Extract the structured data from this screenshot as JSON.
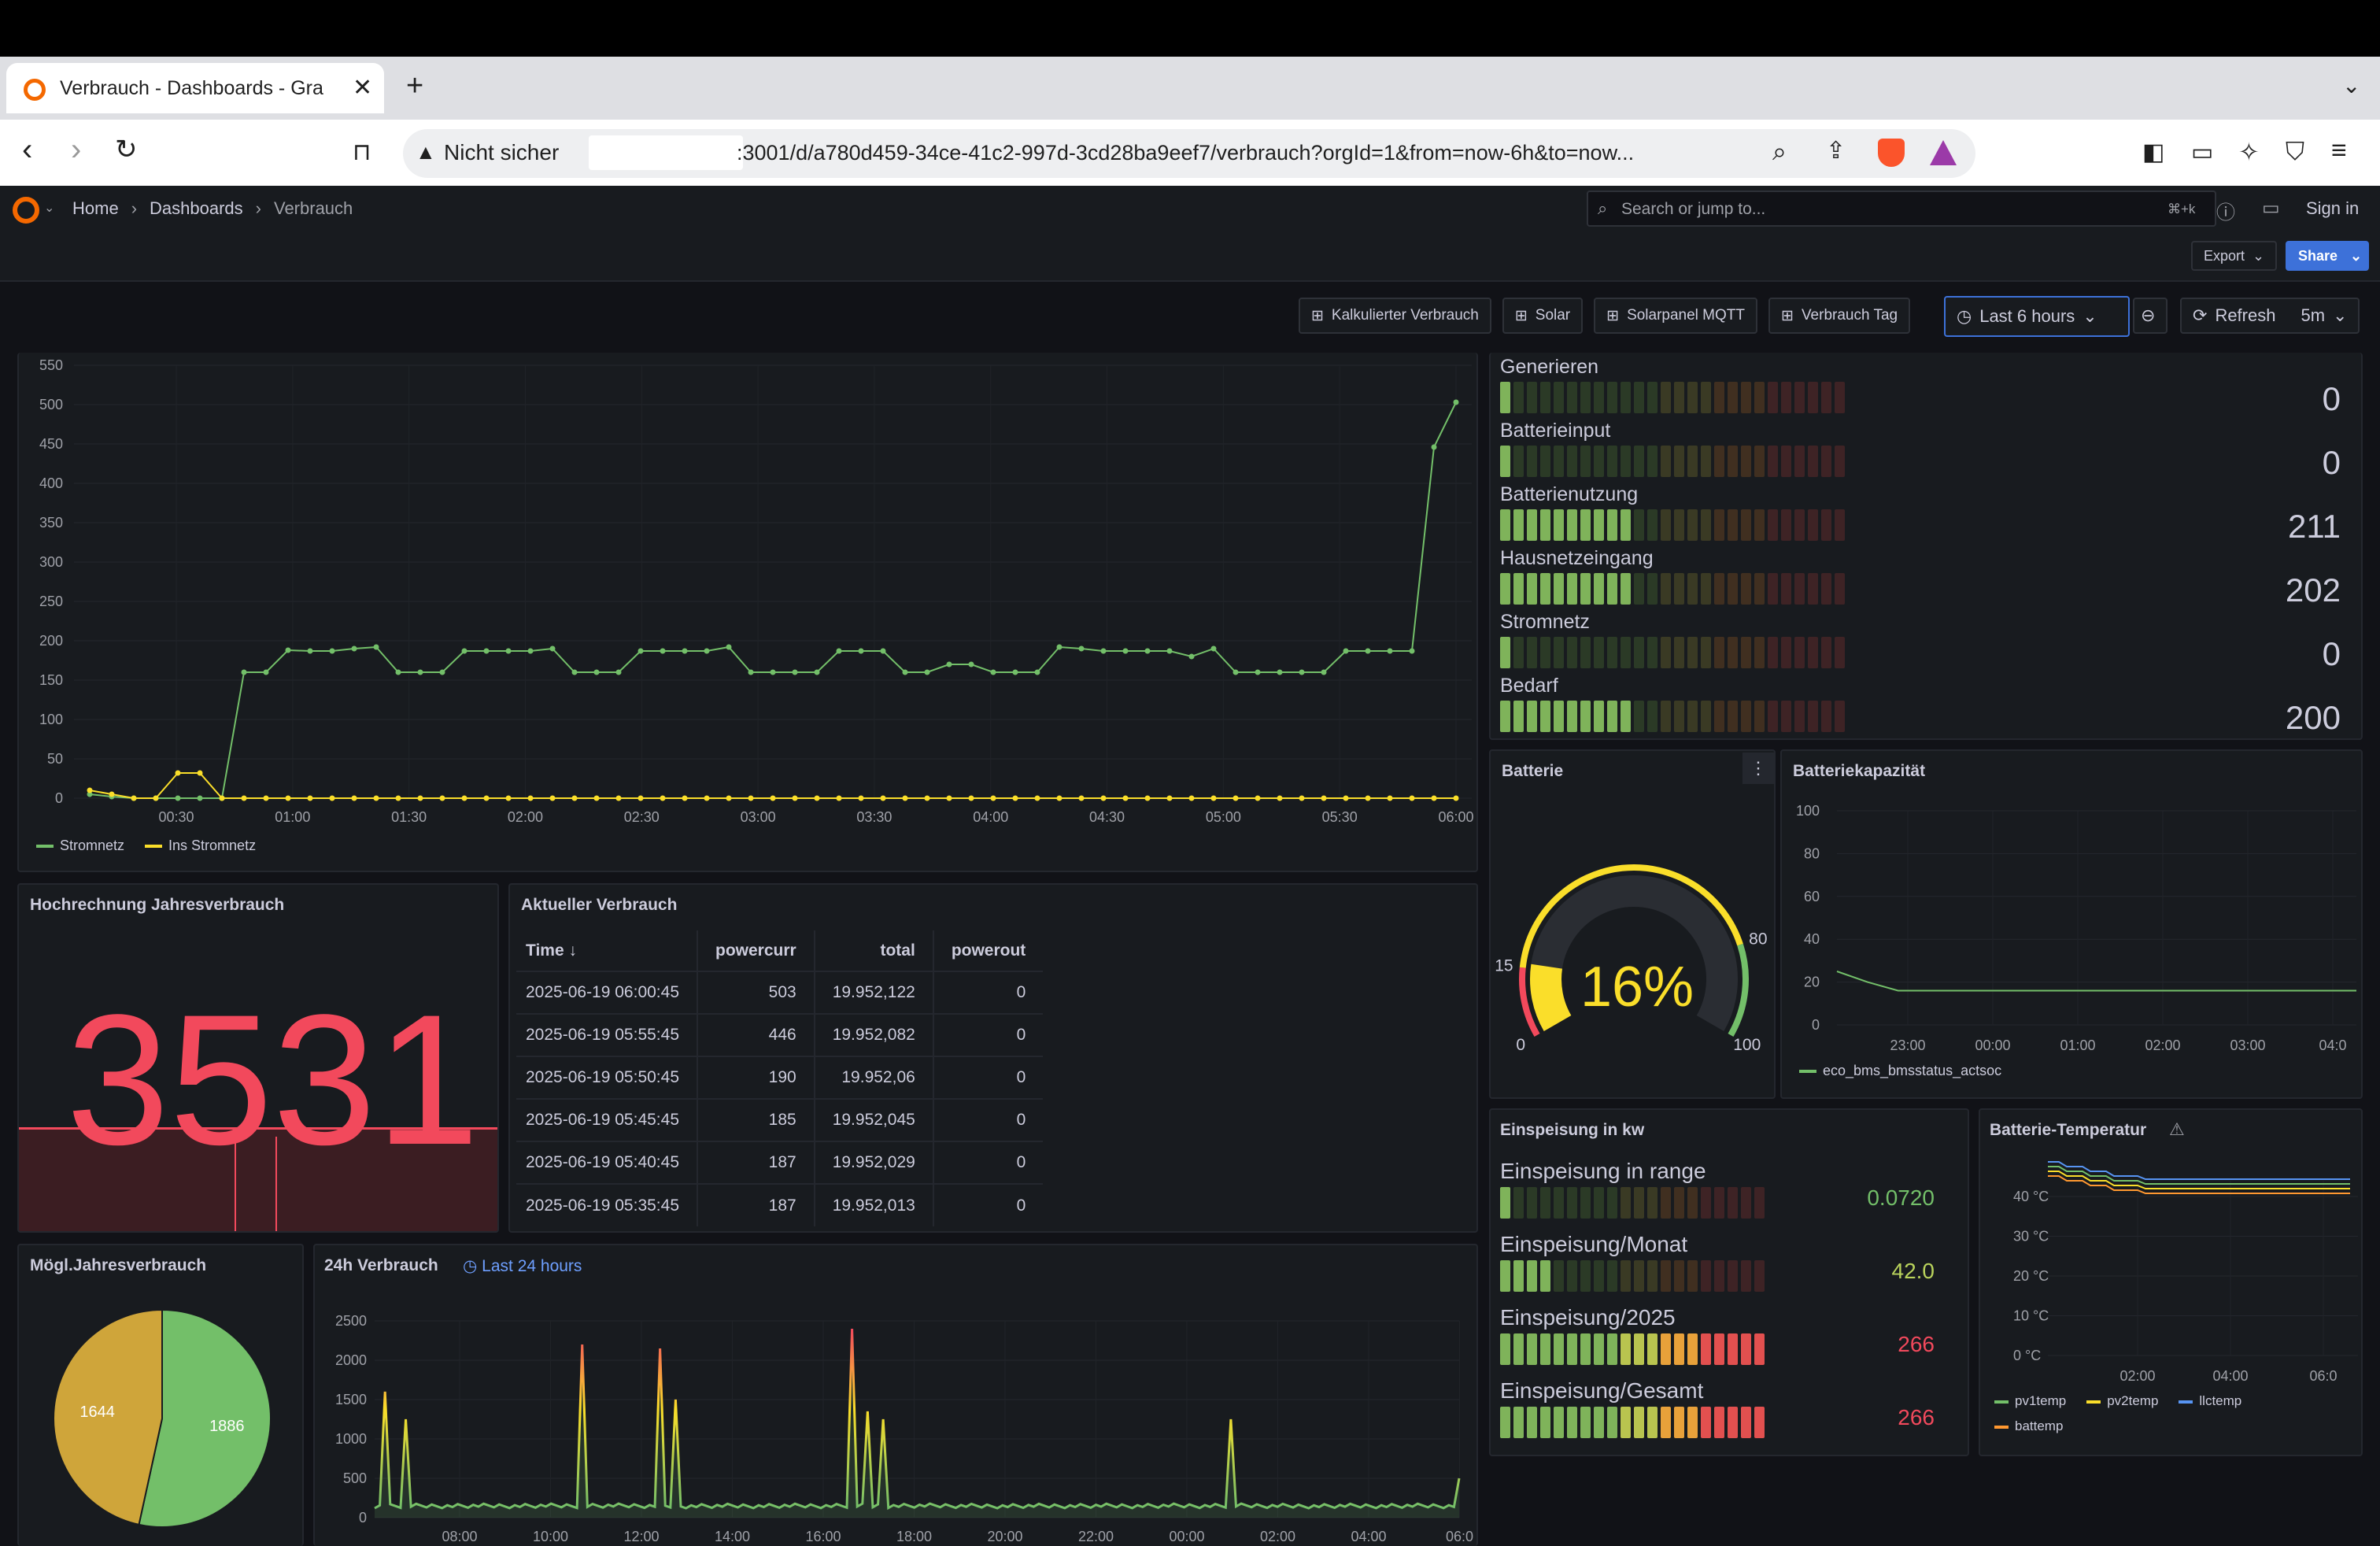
{
  "browser": {
    "tab_title": "Verbrauch - Dashboards - Gra",
    "security_label": "Nicht sicher",
    "url": ":3001/d/a780d459-34ce-41c2-997d-3cd28ba9eef7/verbrauch?orgId=1&from=now-6h&to=now..."
  },
  "grafana": {
    "breadcrumb": [
      "Home",
      "Dashboards",
      "Verbrauch"
    ],
    "search_placeholder": "Search or jump to...",
    "shortcut": "⌘+k",
    "sign_in": "Sign in",
    "export": "Export",
    "share": "Share",
    "links": [
      "Kalkulierter Verbrauch",
      "Solar",
      "Solarpanel MQTT",
      "Verbrauch Tag"
    ],
    "time_range": "Last 6 hours",
    "refresh": "Refresh",
    "refresh_interval": "5m"
  },
  "main_chart": {
    "legend": [
      "Stromnetz",
      "Ins Stromnetz"
    ],
    "colors": [
      "#73bf69",
      "#fade2a"
    ],
    "yticks": [
      "550",
      "500",
      "450",
      "400",
      "350",
      "300",
      "250",
      "200",
      "150",
      "100",
      "50",
      "0"
    ],
    "xticks": [
      "00:30",
      "01:00",
      "01:30",
      "02:00",
      "02:30",
      "03:00",
      "03:30",
      "04:00",
      "04:30",
      "05:00",
      "05:30",
      "06:00"
    ],
    "chart_data": {
      "type": "line",
      "ylim": [
        0,
        550
      ],
      "series": [
        {
          "name": "Stromnetz",
          "values": [
            5,
            2,
            0,
            0,
            0,
            0,
            0,
            160,
            160,
            188,
            187,
            187,
            190,
            192,
            160,
            160,
            160,
            187,
            187,
            187,
            187,
            190,
            160,
            160,
            160,
            187,
            187,
            187,
            187,
            192,
            160,
            160,
            160,
            160,
            187,
            187,
            187,
            160,
            160,
            170,
            170,
            160,
            160,
            160,
            192,
            190,
            187,
            187,
            187,
            187,
            180,
            190,
            160,
            160,
            160,
            160,
            160,
            187,
            187,
            187,
            187,
            446,
            503
          ]
        },
        {
          "name": "Ins Stromnetz",
          "values": [
            10,
            5,
            0,
            0,
            32,
            32,
            0,
            0,
            0,
            0,
            0,
            0,
            0,
            0,
            0,
            0,
            0,
            0,
            0,
            0,
            0,
            0,
            0,
            0,
            0,
            0,
            0,
            0,
            0,
            0,
            0,
            0,
            0,
            0,
            0,
            0,
            0,
            0,
            0,
            0,
            0,
            0,
            0,
            0,
            0,
            0,
            0,
            0,
            0,
            0,
            0,
            0,
            0,
            0,
            0,
            0,
            0,
            0,
            0,
            0,
            0,
            0,
            0
          ]
        }
      ]
    }
  },
  "bargauges": [
    {
      "name": "Generieren",
      "value": "0",
      "lit": 1
    },
    {
      "name": "Batterieinput",
      "value": "0",
      "lit": 1
    },
    {
      "name": "Batterienutzung",
      "value": "211",
      "lit": 10
    },
    {
      "name": "Hausnetzeingang",
      "value": "202",
      "lit": 10
    },
    {
      "name": "Stromnetz",
      "value": "0",
      "lit": 1
    },
    {
      "name": "Bedarf",
      "value": "200",
      "lit": 10
    }
  ],
  "hochrechnung": {
    "title": "Hochrechnung Jahresverbrauch",
    "value": "3531"
  },
  "aktuell": {
    "title": "Aktueller Verbrauch",
    "columns": [
      "Time",
      "powercurr",
      "total",
      "powerout"
    ],
    "rows": [
      [
        "2025-06-19 06:00:45",
        "503",
        "19.952,122",
        "0"
      ],
      [
        "2025-06-19 05:55:45",
        "446",
        "19.952,082",
        "0"
      ],
      [
        "2025-06-19 05:50:45",
        "190",
        "19.952,06",
        "0"
      ],
      [
        "2025-06-19 05:45:45",
        "185",
        "19.952,045",
        "0"
      ],
      [
        "2025-06-19 05:40:45",
        "187",
        "19.952,029",
        "0"
      ],
      [
        "2025-06-19 05:35:45",
        "187",
        "19.952,013",
        "0"
      ]
    ]
  },
  "batterie": {
    "title": "Batterie",
    "value": "16%",
    "ticks": [
      "0",
      "15",
      "80",
      "100"
    ],
    "percent": 16
  },
  "kapazitaet": {
    "title": "Batteriekapazität",
    "yticks": [
      "100",
      "80",
      "60",
      "40",
      "20",
      "0"
    ],
    "xticks": [
      "23:00",
      "00:00",
      "01:00",
      "02:00",
      "03:00",
      "04:0"
    ],
    "legend": "eco_bms_bmsstatus_actsoc",
    "chart_data": {
      "type": "line",
      "ylim": [
        0,
        100
      ],
      "series": [
        {
          "name": "eco_bms_bmsstatus_actsoc",
          "values": [
            25,
            20,
            16,
            16,
            16,
            16,
            16,
            16,
            16,
            16,
            16,
            16,
            16,
            16,
            16,
            16,
            16,
            16
          ]
        }
      ]
    }
  },
  "einspeisung": {
    "title": "Einspeisung in kw",
    "items": [
      {
        "name": "Einspeisung in range",
        "value": "0.0720",
        "color": "#73bf69",
        "lit": 1
      },
      {
        "name": "Einspeisung/Monat",
        "value": "42.0",
        "color": "#b9d35c",
        "lit": 4
      },
      {
        "name": "Einspeisung/2025",
        "value": "266",
        "color": "#f2495c",
        "lit": 20
      },
      {
        "name": "Einspeisung/Gesamt",
        "value": "266",
        "color": "#f2495c",
        "lit": 20
      }
    ]
  },
  "temperatur": {
    "title": "Batterie-Temperatur",
    "yticks": [
      "40 °C",
      "30 °C",
      "20 °C",
      "10 °C",
      "0 °C"
    ],
    "xticks": [
      "02:00",
      "04:00",
      "06:0"
    ],
    "legend": [
      "pv1temp",
      "pv2temp",
      "llctemp",
      "battemp"
    ],
    "colors": [
      "#73bf69",
      "#fade2a",
      "#5794f2",
      "#ff9830"
    ]
  },
  "moegl": {
    "title": "Mögl.Jahresverbrauch",
    "chart_data": {
      "type": "pie",
      "values": [
        1886,
        1644
      ],
      "colors": [
        "#73bf69",
        "#cfa53a"
      ]
    }
  },
  "verbrauch24": {
    "title": "24h Verbrauch",
    "time_badge": "Last 24 hours",
    "yticks": [
      "2500",
      "2000",
      "1500",
      "1000",
      "500",
      "0"
    ],
    "xticks": [
      "08:00",
      "10:00",
      "12:00",
      "14:00",
      "16:00",
      "18:00",
      "20:00",
      "22:00",
      "00:00",
      "02:00",
      "04:00",
      "06:0"
    ]
  }
}
